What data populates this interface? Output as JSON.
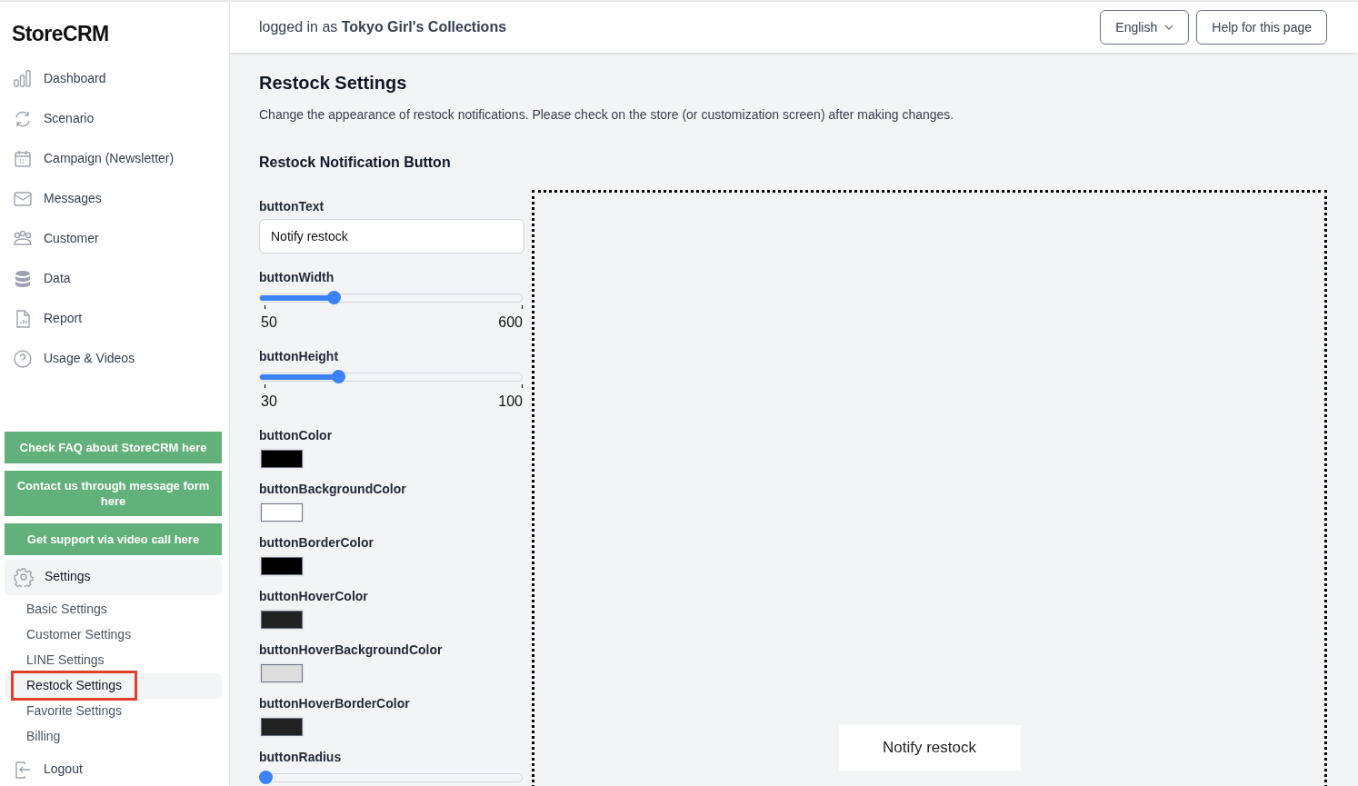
{
  "sidebar": {
    "logo": "StoreCRM",
    "nav": [
      {
        "label": "Dashboard"
      },
      {
        "label": "Scenario"
      },
      {
        "label": "Campaign (Newsletter)"
      },
      {
        "label": "Messages"
      },
      {
        "label": "Customer"
      },
      {
        "label": "Data"
      },
      {
        "label": "Report"
      },
      {
        "label": "Usage & Videos"
      }
    ],
    "support_buttons": [
      "Check FAQ about StoreCRM here",
      "Contact us through message form here",
      "Get support via video call here"
    ],
    "settings": {
      "label": "Settings",
      "expanded": true,
      "children": [
        {
          "label": "Basic Settings",
          "selected": false,
          "highlighted": false
        },
        {
          "label": "Customer Settings",
          "selected": false,
          "highlighted": false
        },
        {
          "label": "LINE Settings",
          "selected": false,
          "highlighted": false
        },
        {
          "label": "Restock Settings",
          "selected": true,
          "highlighted": true
        },
        {
          "label": "Favorite Settings",
          "selected": false,
          "highlighted": false
        },
        {
          "label": "Billing",
          "selected": false,
          "highlighted": false
        }
      ]
    },
    "logout": "Logout"
  },
  "header": {
    "logged_in": "logged in as **Tokyo Girl's Collections**",
    "language": "English",
    "help": "Help for this page"
  },
  "page": {
    "title": "Restock Settings",
    "description": "Change the appearance of restock notifications. Please check on the store (or customization screen) after making changes.",
    "section": "Restock Notification Button",
    "fields": [
      {
        "kind": "text",
        "label": "buttonText",
        "value": "Notify restock"
      },
      {
        "kind": "slider",
        "label": "buttonWidth",
        "level": 0.28,
        "min": "50",
        "max": "600"
      },
      {
        "kind": "slider",
        "label": "buttonHeight",
        "level": 0.3,
        "min": "30",
        "max": "100"
      },
      {
        "kind": "color",
        "label": "buttonColor",
        "color": "#000000"
      },
      {
        "kind": "color",
        "label": "buttonBackgroundColor",
        "color": "#ffffff"
      },
      {
        "kind": "color",
        "label": "buttonBorderColor",
        "color": "#000000"
      },
      {
        "kind": "color",
        "label": "buttonHoverColor",
        "color": "#222222"
      },
      {
        "kind": "color",
        "label": "buttonHoverBackgroundColor",
        "color": "#dddddd"
      },
      {
        "kind": "color",
        "label": "buttonHoverBorderColor",
        "color": "#222222"
      },
      {
        "kind": "slider",
        "label": "buttonRadius",
        "level": 0.02
      }
    ],
    "preview": {
      "button": "Notify restock"
    }
  }
}
